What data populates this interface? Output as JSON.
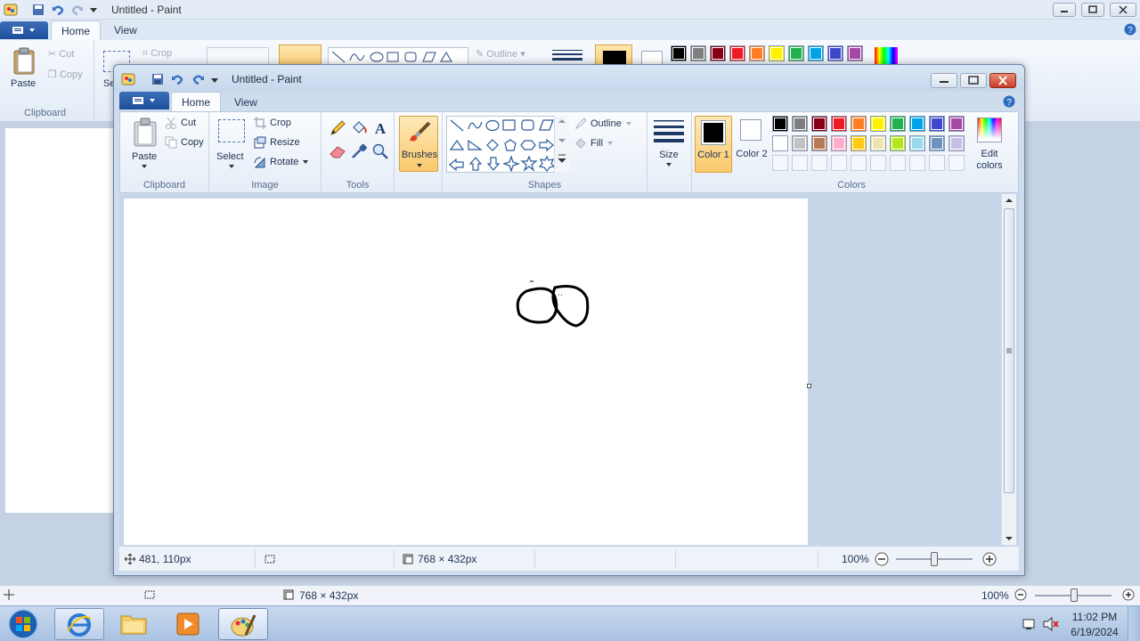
{
  "background_window": {
    "title": "Untitled - Paint",
    "tabs": [
      "Home",
      "View"
    ],
    "ribbon": {
      "cut": "Cut",
      "copy": "Copy",
      "paste": "Paste",
      "clipboard": "Clipboard",
      "crop": "Crop",
      "select_partial": "Se",
      "outline": "Outline"
    },
    "status": {
      "dimensions": "768 × 432px",
      "zoom": "100%"
    }
  },
  "window": {
    "title": "Untitled - Paint",
    "tabs": {
      "home": "Home",
      "view": "View"
    },
    "clipboard": {
      "paste": "Paste",
      "cut": "Cut",
      "copy": "Copy",
      "label": "Clipboard"
    },
    "image": {
      "select": "Select",
      "crop": "Crop",
      "resize": "Resize",
      "rotate": "Rotate",
      "label": "Image"
    },
    "tools": {
      "label": "Tools"
    },
    "brushes": {
      "label": "Brushes"
    },
    "shapes": {
      "outline": "Outline",
      "fill": "Fill",
      "label": "Shapes"
    },
    "size": {
      "label": "Size"
    },
    "colors": {
      "color1": "Color 1",
      "color2": "Color 2",
      "edit": "Edit colors",
      "label": "Colors",
      "color1_value": "#000000",
      "color2_value": "#ffffff",
      "row1": [
        "#000000",
        "#7f7f7f",
        "#880015",
        "#ed1c24",
        "#ff7f27",
        "#fff200",
        "#22b14c",
        "#00a2e8",
        "#3f48cc",
        "#a349a4"
      ],
      "row2": [
        "#ffffff",
        "#c3c3c3",
        "#b97a57",
        "#ffaec9",
        "#ffc90e",
        "#efe4b0",
        "#b5e61d",
        "#99d9ea",
        "#7092be",
        "#c8bfe7"
      ]
    },
    "status": {
      "cursor": "481, 110px",
      "dimensions": "768 × 432px",
      "zoom": "100%",
      "zoom_level": 0.5
    }
  },
  "taskbar": {
    "time": "11:02 PM",
    "date": "6/19/2024"
  }
}
